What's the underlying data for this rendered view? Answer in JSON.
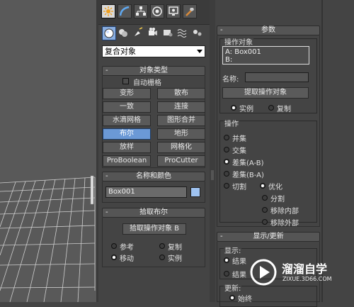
{
  "tabs": [
    "create-icon",
    "modify-icon",
    "hierarchy-icon",
    "motion-icon",
    "display-icon",
    "utilities-icon"
  ],
  "category_icons": [
    "geometry-icon",
    "shapes-icon",
    "lights-icon",
    "cameras-icon",
    "helpers-icon",
    "spacewarps-icon",
    "systems-icon"
  ],
  "dropdown": {
    "value": "复合对象"
  },
  "object_type": {
    "title": "对象类型",
    "autogrid": "自动栅格",
    "buttons": [
      "变形",
      "散布",
      "一致",
      "连接",
      "水滴网格",
      "图形合并",
      "布尔",
      "地形",
      "放样",
      "网格化",
      "ProBoolean",
      "ProCutter"
    ],
    "pressed": "布尔"
  },
  "name_color": {
    "title": "名称和颜色",
    "name": "Box001",
    "swatch": "#9fc3f1"
  },
  "pick_boolean": {
    "title": "拾取布尔",
    "button": "拾取操作对象 B",
    "options": [
      "参考",
      "复制",
      "移动",
      "实例"
    ],
    "selected": "移动"
  },
  "params": {
    "title": "参数",
    "operands_label": "操作对象",
    "operands": [
      "A: Box001",
      "B:"
    ],
    "name_label": "名称:",
    "extract_button": "提取操作对象",
    "extract_modes": [
      "实例",
      "复制"
    ],
    "extract_selected": "实例",
    "operation_label": "操作",
    "operations": [
      "并集",
      "交集",
      "差集(A-B)",
      "差集(B-A)",
      "切割"
    ],
    "operation_selected": "差集(A-B)",
    "cut_modes": [
      "优化",
      "分割",
      "移除内部",
      "移除外部"
    ],
    "cut_selected": "优化"
  },
  "display_update": {
    "title": "显示/更新",
    "display_label": "显示:",
    "display_options": [
      "结果",
      "结果"
    ],
    "update_label": "更新:",
    "update_options": [
      "始终"
    ]
  },
  "watermark": {
    "title": "溜溜自学",
    "url": "ZIXUE.3D66.COM"
  },
  "colors": {
    "panel": "#444444",
    "pressed": "#6b99d6",
    "viewport": "#595959"
  }
}
